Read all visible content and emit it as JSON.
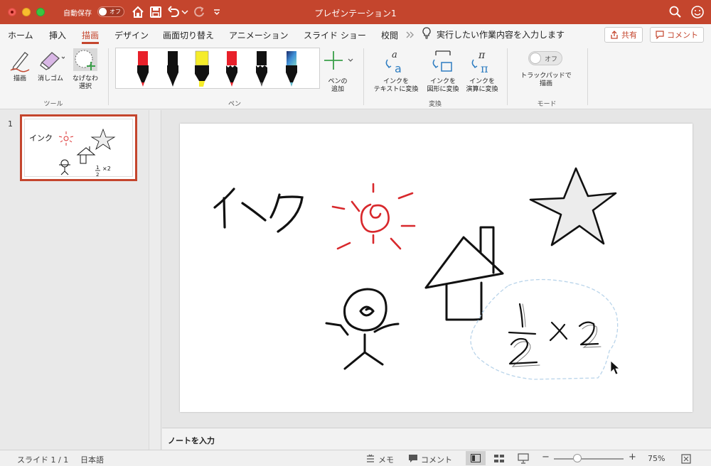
{
  "titlebar": {
    "autosave_label": "自動保存",
    "autosave_state": "オフ",
    "document_title": "プレゼンテーション1",
    "accent_color": "#c4452d"
  },
  "tabs": [
    "ホーム",
    "挿入",
    "描画",
    "デザイン",
    "画面切り替え",
    "アニメーション",
    "スライド ショー",
    "校閲"
  ],
  "active_tab": "描画",
  "tell_me": "実行したい作業内容を入力します",
  "share_label": "共有",
  "comment_label": "コメント",
  "ribbon": {
    "tools": {
      "draw": "描画",
      "eraser": "消しゴム",
      "lasso_line1": "なげなわ",
      "lasso_line2": "選択",
      "group": "ツール"
    },
    "pens": {
      "colors": [
        "#e8202a",
        "#111111",
        "#f5ec2a",
        "#e8202a",
        "#111111",
        "#2f6fb3"
      ],
      "add_line1": "ペンの",
      "add_line2": "追加",
      "group": "ペン"
    },
    "convert": {
      "to_text_line1": "インクを",
      "to_text_line2": "テキストに変換",
      "to_shape_line1": "インクを",
      "to_shape_line2": "図形に変換",
      "to_math_line1": "インクを",
      "to_math_line2": "演算に変換",
      "group": "変換"
    },
    "mode": {
      "toggle_state": "オフ",
      "trackpad_line1": "トラックパッドで",
      "trackpad_line2": "描画",
      "group": "モード"
    }
  },
  "slides": {
    "current_number": "1",
    "thumb_text": "インク"
  },
  "slide": {
    "ink_text": "インク",
    "math_num": "1",
    "math_den": "2",
    "math_rest": "×2"
  },
  "notes_placeholder": "ノートを入力",
  "statusbar": {
    "slide_info": "スライド 1 / 1",
    "language": "日本語",
    "notes_btn": "メモ",
    "comments_btn": "コメント",
    "zoom_level": "75%",
    "zoom_fraction": 0.34
  }
}
